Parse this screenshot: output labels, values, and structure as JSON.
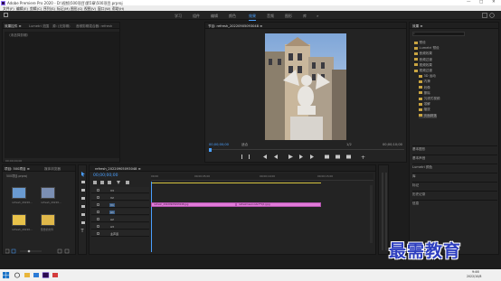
{
  "window": {
    "title": "Adobe Premiere Pro 2020 - D:\\视频\\500项目\\第5章\\500项目.prproj",
    "minimize": "—",
    "maximize": "□",
    "close": "✕"
  },
  "menu": [
    "文件(F)",
    "编辑(E)",
    "剪辑(C)",
    "序列(S)",
    "标记(M)",
    "图形(G)",
    "视图(V)",
    "窗口(W)",
    "帮助(H)"
  ],
  "workspaces": {
    "items": [
      "学习",
      "组件",
      "编辑",
      "颜色",
      "效果",
      "音频",
      "图形",
      "库"
    ],
    "active_index": 4,
    "more": "»"
  },
  "source_panel": {
    "tabs": [
      "效果控件 ≡",
      "Lumetri 范围",
      "源: (无剪辑)",
      "音频剪辑混合器: refresh"
    ],
    "empty_text": "（未选择剪辑）",
    "timecode": "00;00;00;00"
  },
  "program_monitor": {
    "tab": "节目: refresh_20220905093048 ≡",
    "timecode_left": "00;00;00;00",
    "fit": "适合",
    "ratio": "1/2",
    "timecode_right": "00;00;10;00"
  },
  "effects_panel": {
    "title": "效果 ≡",
    "items": [
      {
        "label": "预设",
        "level": 0
      },
      {
        "label": "Lumetri 预设",
        "level": 0
      },
      {
        "label": "音频效果",
        "level": 0
      },
      {
        "label": "音频过渡",
        "level": 0
      },
      {
        "label": "视频效果",
        "level": 0
      },
      {
        "label": "视频过渡",
        "level": 0
      },
      {
        "label": "3D 运动",
        "level": 1
      },
      {
        "label": "内滑",
        "level": 1
      },
      {
        "label": "划像",
        "level": 1
      },
      {
        "label": "擦除",
        "level": 1
      },
      {
        "label": "沉浸式视频",
        "level": 1
      },
      {
        "label": "溶解",
        "level": 1
      },
      {
        "label": "缩放",
        "level": 1
      },
      {
        "label": "页面剥落",
        "level": 1
      }
    ],
    "lower_items": [
      "基本图形",
      "基本声音",
      "Lumetri 颜色",
      "库",
      "标记",
      "历史记录",
      "信息"
    ]
  },
  "project_panel": {
    "tabs": [
      "项目: 500项目 ≡",
      "媒体浏览器"
    ],
    "path": "500项目.prproj",
    "items": [
      {
        "caption": "refresh_20220...",
        "color": "#6a9ad0"
      },
      {
        "caption": "refresh_20220...",
        "color": "#7b8fb3"
      },
      {
        "caption": "refresh_20220...",
        "color": "#e8c24a"
      },
      {
        "caption": "警告的文件",
        "color": "#e0b84a"
      }
    ]
  },
  "timeline": {
    "tab": "refresh_20220905093048 ≡",
    "timecode": "00;00;00;00",
    "ruler": [
      "00;00",
      "00;00;05;00",
      "00;00;10;00",
      "00;00;15;00"
    ],
    "tracks": [
      "V3",
      "V2",
      "V1",
      "A1",
      "A2",
      "A3",
      "主声道"
    ],
    "clips": [
      {
        "label": "refresh_20220905093048.jpg",
        "start": 0,
        "end": 5
      },
      {
        "label": "refresh1seconds7*5(1).jpg",
        "start": 5,
        "end": 10
      }
    ]
  },
  "taskbar": {
    "time": "9:46",
    "date": "2022/10/8"
  },
  "watermark": "最需教育"
}
